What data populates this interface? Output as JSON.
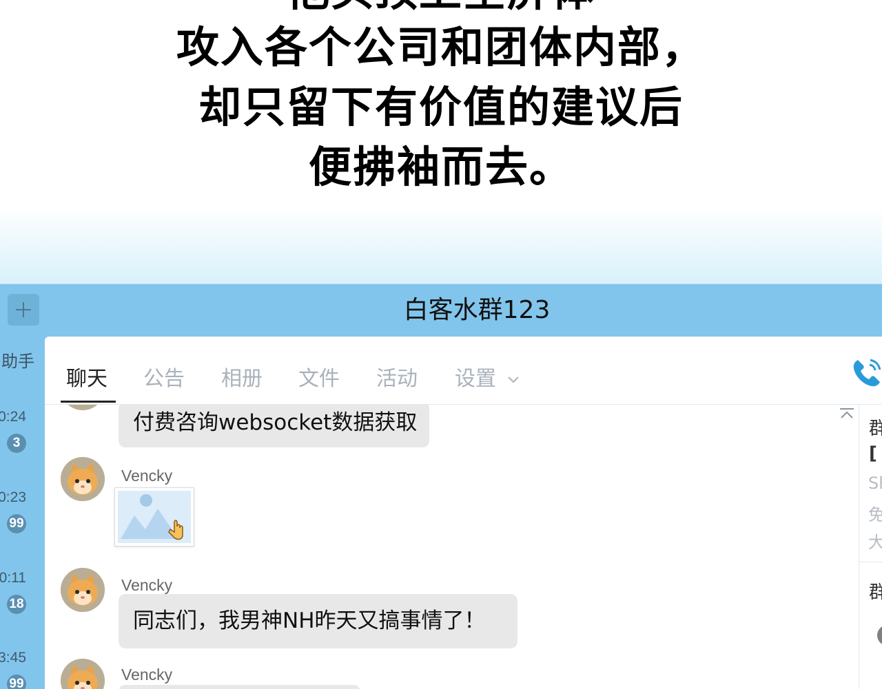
{
  "caption": {
    "lines": [
      "他头顶上全屏体",
      "攻入各个公司和团体内部，",
      "却只留下有价值的建议后",
      "便拂袖而去。"
    ]
  },
  "left_rail": {
    "add_label": "+",
    "items": [
      {
        "label": "助手"
      },
      {
        "time": "0:24",
        "badge": "3"
      },
      {
        "time": "0:23",
        "badge": "99"
      },
      {
        "time": "0:11",
        "badge": "18"
      },
      {
        "time": "3:45",
        "badge": "99"
      }
    ]
  },
  "header": {
    "title": "白客水群123"
  },
  "tabs": [
    {
      "label": "聊天",
      "active": true
    },
    {
      "label": "公告"
    },
    {
      "label": "相册"
    },
    {
      "label": "文件"
    },
    {
      "label": "活动"
    },
    {
      "label": "设置"
    }
  ],
  "messages": [
    {
      "text": "付费咨询websocket数据获取"
    },
    {
      "sender": "Vencky",
      "type": "image"
    },
    {
      "sender": "Vencky",
      "text": "同志们，我男神NH昨天又搞事情了！"
    },
    {
      "sender": "Vencky"
    }
  ],
  "side_panel": {
    "lines": [
      "群",
      "[",
      "Sh",
      "免",
      "大",
      "群"
    ]
  },
  "colors": {
    "app_bg": "#82c5ec",
    "badge": "#5a8fb2",
    "bubble": "#e8e8e8",
    "phone": "#2a9bd8"
  }
}
